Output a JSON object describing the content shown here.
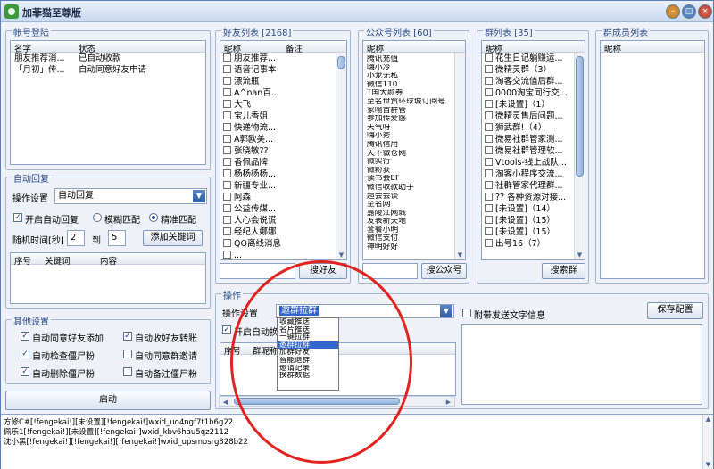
{
  "window": {
    "title": "加菲猫至尊版"
  },
  "account": {
    "group_title": "帐号登陆",
    "columns": [
      "名字",
      "状态"
    ],
    "rows": [
      [
        "朋友推荐消...",
        "已自动收款"
      ],
      [
        "「月初」传...",
        "自动同意好友申请"
      ]
    ]
  },
  "friends": {
    "group_title": "好友列表 [2168]",
    "columns": [
      "昵称",
      "备注"
    ],
    "items": [
      "朋友推荐...",
      "语音记事本",
      "漂流瓶",
      "A^nan百...",
      "大飞",
      "宝儿香姐",
      "快递物流...",
      "A郭欧美...",
      "张晓敏??",
      "香佩品牌",
      "杨杨杨杨...",
      "新疆专业...",
      "阿森",
      "公益传媒...",
      "人心会说谎",
      "经纪人娜娜",
      "QQ离线消息",
      "..."
    ],
    "search_value": "",
    "search_button": "搜好友"
  },
  "public_accounts": {
    "group_title": "公众号列表 [60]",
    "columns": [
      "昵称"
    ],
    "items": [
      "腾讯充值",
      "嗨小冷",
      "小龙无私",
      "微信110",
      "T国大颜券",
      "至名世贸环球城订阅号",
      "家喻首群管",
      "参加传爱感",
      "天气呀",
      "嗨小秀",
      "腾讯信用",
      "天下微仓网",
      "微实行",
      "微粉获",
      "读书会EF",
      "微信收款助手",
      "超会会谈",
      "至名网",
      "嘉陵江网城",
      "发表新天地",
      "套餐小明",
      "微信支付",
      "神明好好"
    ],
    "search_value": "",
    "search_button": "搜公众号"
  },
  "groups": {
    "group_title": "群列表 [35]",
    "columns": [
      "昵称"
    ],
    "items": [
      "花生日记躺赚运...",
      "微精灵群（3）",
      "淘客交流值后群...",
      "0000淘宝同行交...",
      "[未设置]（1）",
      "微精灵售后问题...",
      "狮武群!（4）",
      "微易社群管家测...",
      "微易社群管理软...",
      "Vtools-线上战队...",
      "淘客小程序交流...",
      "社群管家代理群...",
      "?? 各种资源对接...",
      "[未设置]（14）",
      "[未设置]（15）",
      "[未设置]（15）",
      "出号16（7）"
    ],
    "search_value": "",
    "search_button": "搜索群"
  },
  "members": {
    "group_title": "群成员列表",
    "columns": [
      "昵称"
    ]
  },
  "auto_reply": {
    "group_title": "自动回复",
    "op_label": "操作设置",
    "op_value": "自动回复",
    "enable_label": "开启自动回复",
    "fuzzy_label": "模糊匹配",
    "exact_label": "精准匹配",
    "random_label": "随机时间[秒]",
    "random_from": "2",
    "to_label": "到",
    "random_to": "5",
    "add_keyword_button": "添加关键词",
    "columns": [
      "序号",
      "关键词",
      "内容"
    ]
  },
  "other_settings": {
    "group_title": "其他设置",
    "options": [
      {
        "label": "自动同意好友添加",
        "checked": true
      },
      {
        "label": "自动收好友转账",
        "checked": true
      },
      {
        "label": "自动检查僵尸粉",
        "checked": true
      },
      {
        "label": "自动同意群邀请",
        "checked": false
      },
      {
        "label": "自动删除僵尸粉",
        "checked": true
      },
      {
        "label": "自动备注僵尸粉",
        "checked": false
      }
    ]
  },
  "start_button": "启动",
  "operation": {
    "group_title": "操作",
    "op_label": "操作设置",
    "op_value": "邀群拉群",
    "auto_label": "开启自动换群",
    "table_columns": [
      "序号",
      "群昵称"
    ],
    "dropdown_options": [
      "收藏推送",
      "名片推送",
      "一键拉群",
      "邀群拉群",
      "加群好友",
      "智能退群",
      "邀请记录",
      "换群数据"
    ],
    "selected_option": "邀群拉群",
    "attach_text_label": "附带发送文字信息",
    "save_button": "保存配置"
  },
  "log": [
    "方修C#[!fengekai!][未设置][!fengekai!]wxid_uo4ngf7t1b6g22",
    "佩乐1[!fengekai!][未设置][!fengekai!]wxid_kbv6hau5qz2112",
    "沈小黑[!fengekai!][!fengekai!][!fengekai!]wxid_upsmosrg328b22"
  ],
  "colors": {
    "accent": "#2e5ba4",
    "annotation": "#e3231f",
    "selection": "#3366cc"
  }
}
